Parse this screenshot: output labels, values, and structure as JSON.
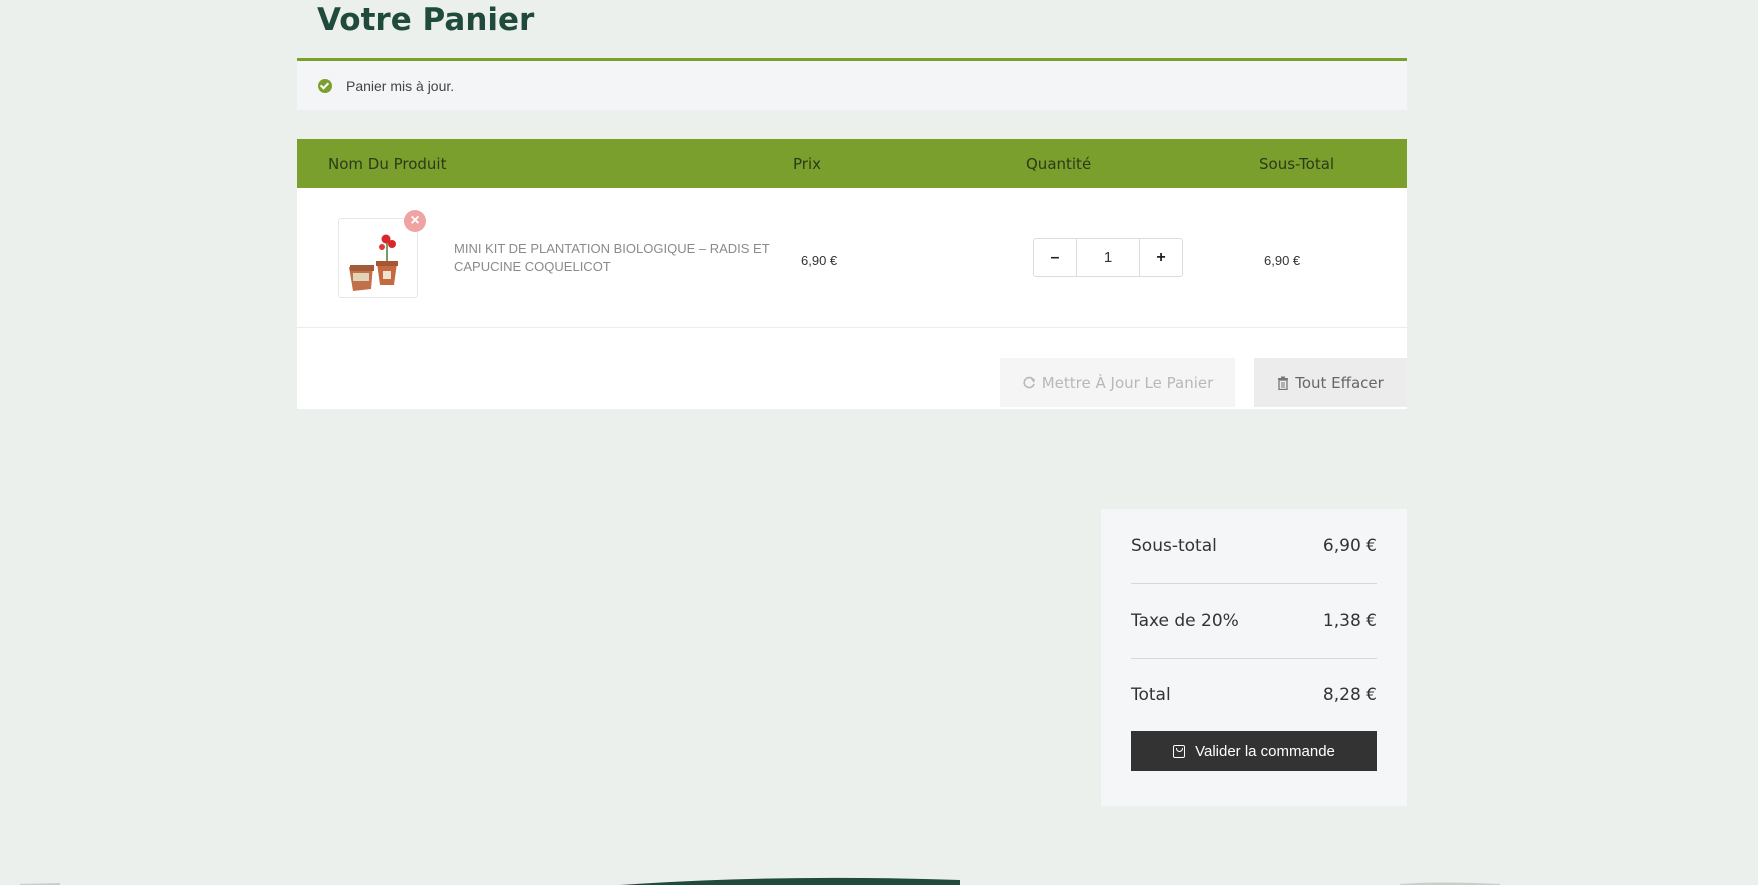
{
  "page": {
    "title": "Votre Panier"
  },
  "notice": {
    "text": "Panier mis à jour."
  },
  "table": {
    "headers": [
      "Nom Du Produit",
      "Prix",
      "Quantité",
      "Sous-Total"
    ],
    "rows": [
      {
        "product": "MINI KIT DE PLANTATION BIOLOGIQUE – RADIS ET CAPUCINE COQUELICOT",
        "price": "6,90 €",
        "quantity": "1",
        "subtotal": "6,90 €"
      }
    ]
  },
  "actions": {
    "update_label": "Mettre À Jour Le Panier",
    "clear_label": "Tout Effacer"
  },
  "totals": {
    "subtotal_label": "Sous-total",
    "subtotal_value": "6,90 €",
    "tax_label": "Taxe de 20%",
    "tax_value": "1,38 €",
    "total_label": "Total",
    "total_value": "8,28 €",
    "checkout_label": "Valider la commande"
  },
  "colors": {
    "accent": "#7a9f2c",
    "title": "#1f4a3c",
    "background": "#ecf0ec"
  },
  "icons": {
    "notice": "check-circle-icon",
    "remove": "close-circle-icon",
    "update": "refresh-icon",
    "clear": "trash-icon",
    "checkout": "shopping-bag-icon"
  }
}
